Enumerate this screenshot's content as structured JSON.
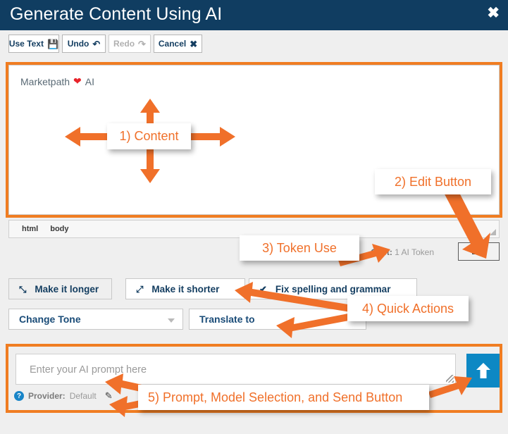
{
  "window": {
    "title": "Generate Content Using AI",
    "close_icon": "close-icon",
    "titlebar_color": "#103d61"
  },
  "toolbar": {
    "buttons": [
      {
        "label": "Use Text",
        "icon": "save-icon",
        "glyph": "💾",
        "enabled": true
      },
      {
        "label": "Undo",
        "icon": "undo-icon",
        "glyph": "↶",
        "enabled": true
      },
      {
        "label": "Redo",
        "icon": "redo-icon",
        "glyph": "↷",
        "enabled": false
      },
      {
        "label": "Cancel",
        "icon": "cancel-icon",
        "glyph": "✖",
        "enabled": true
      }
    ]
  },
  "editor": {
    "content_text": "Marketpath",
    "content_heart": "❤",
    "content_suffix": "AI",
    "status_path": [
      "html",
      "body"
    ],
    "resize_grip": "resize-grip-icon"
  },
  "cost": {
    "label": "Cost:",
    "value": "1 AI Token",
    "edit_button": "Edit"
  },
  "quick_actions": {
    "buttons": [
      {
        "label": "Make it longer",
        "icon": "expand-arrows-icon",
        "glyph": "⤡"
      },
      {
        "label": "Make it shorter",
        "icon": "collapse-arrows-icon",
        "glyph": "⤢"
      },
      {
        "label": "Fix spelling and grammar",
        "icon": "checkmark-icon",
        "glyph": "✔"
      }
    ],
    "selects": [
      {
        "label": "Change Tone",
        "has_caret": true
      },
      {
        "label": "Translate to",
        "has_caret": false
      }
    ]
  },
  "prompt": {
    "placeholder": "Enter your AI prompt here",
    "value": "",
    "send_icon": "send-up-arrow-icon",
    "send_color": "#0d88c4",
    "resize_grip": "textarea-resize-grip-icon",
    "help_icon": "help-question-icon",
    "help_glyph": "?",
    "provider_label": "Provider:",
    "provider_value": "Default",
    "edit_provider_icon": "pencil-icon",
    "pencil_glyph": "✎"
  },
  "annotations": {
    "accent_color": "#f0702a",
    "callouts": [
      {
        "id": "content",
        "text": "1) Content"
      },
      {
        "id": "edit-button",
        "text": "2) Edit Button"
      },
      {
        "id": "token-use",
        "text": "3) Token Use"
      },
      {
        "id": "quick-actions",
        "text": "4) Quick Actions"
      },
      {
        "id": "prompt-send",
        "text": "5) Prompt, Model Selection, and Send Button"
      }
    ]
  }
}
